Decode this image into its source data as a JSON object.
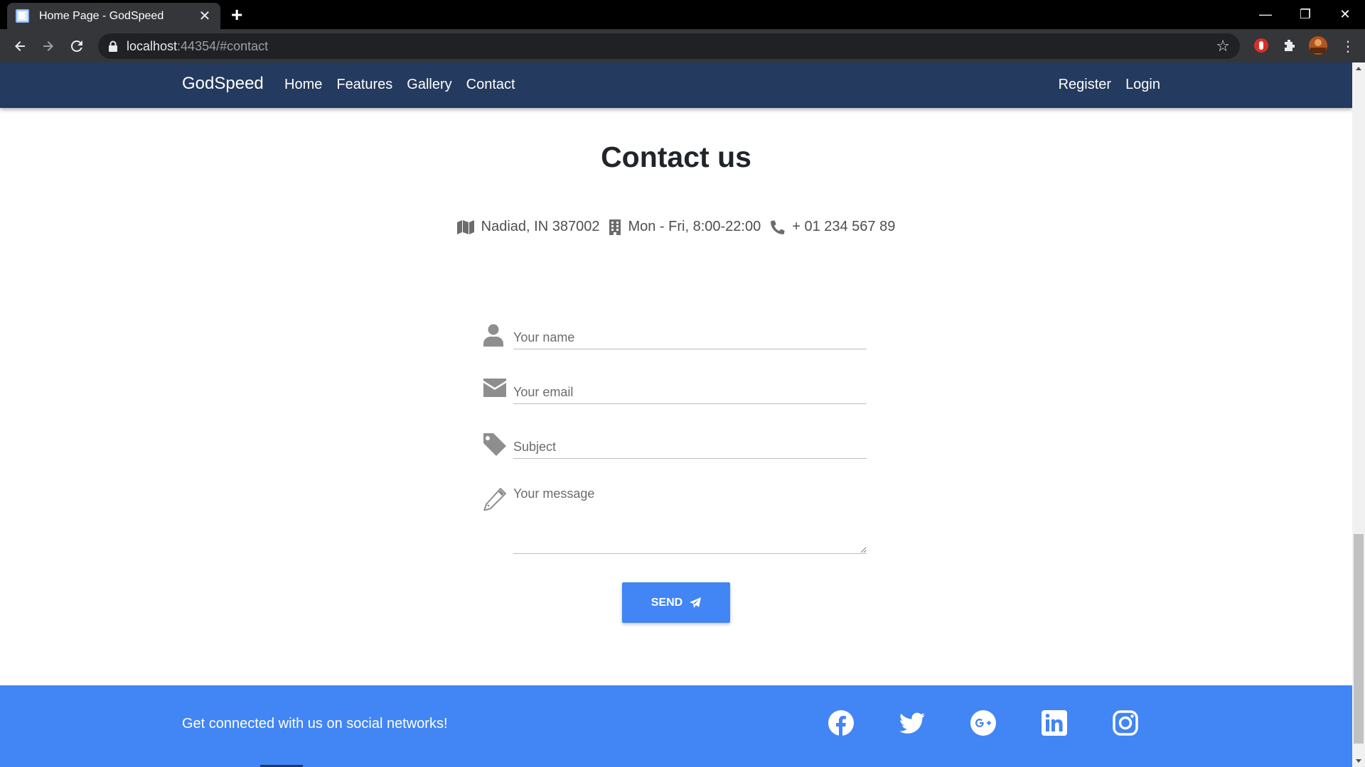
{
  "browser": {
    "tab_title": "Home Page - GodSpeed",
    "tab_close": "✕",
    "new_tab": "+",
    "url_host": "localhost",
    "url_rest": ":44354/#contact",
    "window_controls": [
      "—",
      "❐",
      "✕"
    ]
  },
  "navbar": {
    "brand": "GodSpeed",
    "links": [
      "Home",
      "Features",
      "Gallery",
      "Contact"
    ],
    "right_links": [
      "Register",
      "Login"
    ]
  },
  "contact": {
    "title": "Contact us",
    "address": "Nadiad, IN 387002",
    "hours": "Mon - Fri, 8:00-22:00",
    "phone": "+ 01 234 567 89"
  },
  "form": {
    "name_placeholder": "Your name",
    "email_placeholder": "Your email",
    "subject_placeholder": "Subject",
    "message_placeholder": "Your message",
    "send_label": "SEND"
  },
  "footer": {
    "text": "Get connected with us on social networks!",
    "social_icons": [
      "facebook-icon",
      "twitter-icon",
      "google-plus-icon",
      "linkedin-icon",
      "instagram-icon"
    ]
  },
  "colors": {
    "navbar": "#243a5e",
    "accent": "#4285f4",
    "icon_gray": "#8e8e8e"
  }
}
